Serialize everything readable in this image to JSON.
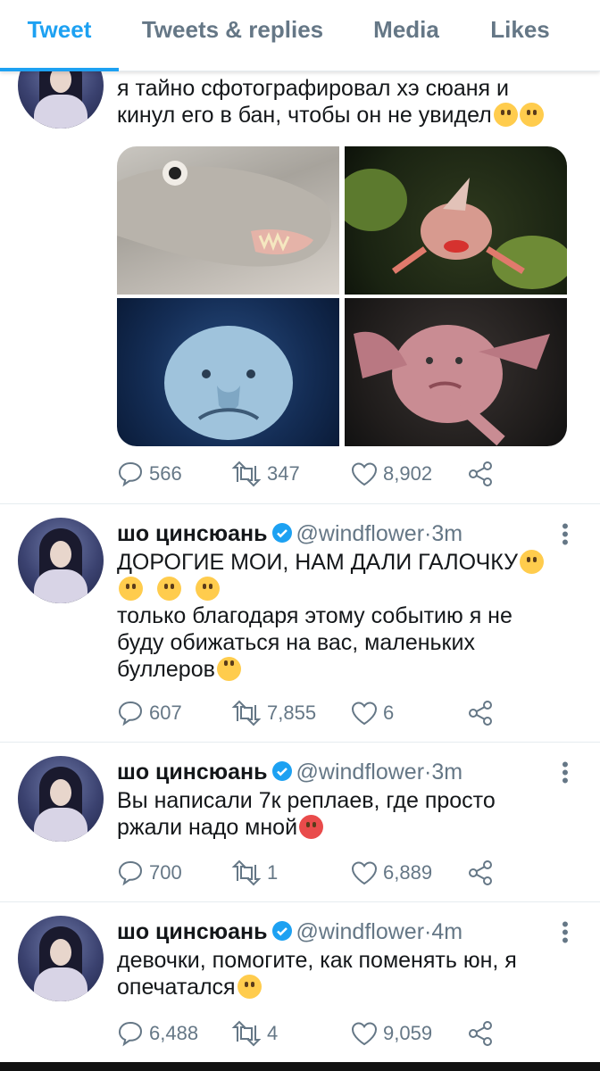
{
  "tabs": [
    {
      "label": "Tweet",
      "active": true
    },
    {
      "label": "Tweets & replies",
      "active": false
    },
    {
      "label": "Media",
      "active": false
    },
    {
      "label": "Likes",
      "active": false
    }
  ],
  "tweets": [
    {
      "text_lines": [
        "я тайно сфотографировал хэ сюаня и",
        "кинул его в бан, чтобы он не увидел"
      ],
      "emoji_end": [
        "shushing-face-emoji",
        "hand-over-mouth-emoji"
      ],
      "images": [
        "fish-photo-1",
        "fish-photo-2",
        "fish-photo-3",
        "fish-photo-4"
      ],
      "replies": "566",
      "retweets": "347",
      "likes": "8,902"
    },
    {
      "name": "шо цинсюань",
      "handle": "@windflower",
      "dot": "·",
      "time": "3m",
      "text_lines": [
        "ДОРОГИЕ МОИ, НАМ ДАЛИ ГАЛОЧКУ",
        "",
        "только благодаря этому событию я не",
        "буду обижаться на вас, маленьких",
        "буллеров"
      ],
      "replies": "607",
      "retweets": "7,855",
      "likes": "6"
    },
    {
      "name": "шо цинсюань",
      "handle": "@windflower",
      "dot": "·",
      "time": "3m",
      "text_lines": [
        "Вы написали 7к реплаев, где просто",
        "ржали надо мной"
      ],
      "replies": "700",
      "retweets": "1",
      "likes": "6,889"
    },
    {
      "name": "шо цинсюань",
      "handle": "@windflower",
      "dot": "·",
      "time": "4m",
      "text_lines": [
        "девочки, помогите, как поменять юн, я",
        "опечатался"
      ],
      "replies": "6,488",
      "retweets": "4",
      "likes": "9,059"
    }
  ],
  "colors": {
    "accent": "#1da1f2",
    "secondary_text": "#657786",
    "divider": "#e6ecf0"
  }
}
